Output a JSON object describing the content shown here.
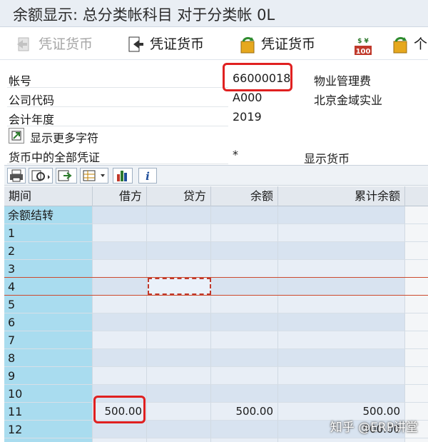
{
  "window": {
    "title": "余额显示: 总分类帐科目 对于分类帐 0L"
  },
  "toolbar": {
    "btn1_label": "凭证货币",
    "btn2_label": "凭证货币",
    "btn3_label": "凭证货币",
    "btn4_icon_text": "$ ¥",
    "btn4_icon_number": "100",
    "btn5_label": "个"
  },
  "form": {
    "account_label": "帐号",
    "account_value": "66000018",
    "account_desc": "物业管理费",
    "company_label": "公司代码",
    "company_value": "A000",
    "company_desc": "北京金域实业",
    "year_label": "会计年度",
    "year_value": "2019",
    "more_fields_label": "显示更多字符",
    "currency_label": "货币中的全部凭证",
    "currency_value": "*",
    "display_currency_label": "显示货币"
  },
  "grid": {
    "headers": {
      "period": "期间",
      "debit": "借方",
      "credit": "贷方",
      "balance": "余额",
      "cumulative": "累计余额"
    },
    "rows": [
      {
        "period": "余额结转",
        "debit": "",
        "credit": "",
        "balance": "",
        "cumulative": ""
      },
      {
        "period": "1",
        "debit": "",
        "credit": "",
        "balance": "",
        "cumulative": ""
      },
      {
        "period": "2",
        "debit": "",
        "credit": "",
        "balance": "",
        "cumulative": ""
      },
      {
        "period": "3",
        "debit": "",
        "credit": "",
        "balance": "",
        "cumulative": ""
      },
      {
        "period": "4",
        "debit": "",
        "credit": "",
        "balance": "",
        "cumulative": ""
      },
      {
        "period": "5",
        "debit": "",
        "credit": "",
        "balance": "",
        "cumulative": ""
      },
      {
        "period": "6",
        "debit": "",
        "credit": "",
        "balance": "",
        "cumulative": ""
      },
      {
        "period": "7",
        "debit": "",
        "credit": "",
        "balance": "",
        "cumulative": ""
      },
      {
        "period": "8",
        "debit": "",
        "credit": "",
        "balance": "",
        "cumulative": ""
      },
      {
        "period": "9",
        "debit": "",
        "credit": "",
        "balance": "",
        "cumulative": ""
      },
      {
        "period": "10",
        "debit": "",
        "credit": "",
        "balance": "",
        "cumulative": ""
      },
      {
        "period": "11",
        "debit": "500.00",
        "credit": "",
        "balance": "500.00",
        "cumulative": "500.00"
      },
      {
        "period": "12",
        "debit": "",
        "credit": "",
        "balance": "",
        "cumulative": "500.00"
      },
      {
        "period": "",
        "debit": "",
        "credit": "",
        "balance": "",
        "cumulative": ""
      }
    ]
  },
  "watermark": {
    "text": "知乎 @ERP讲堂"
  },
  "colors": {
    "highlight": "#e02020",
    "period_column": "#a9dcef"
  }
}
